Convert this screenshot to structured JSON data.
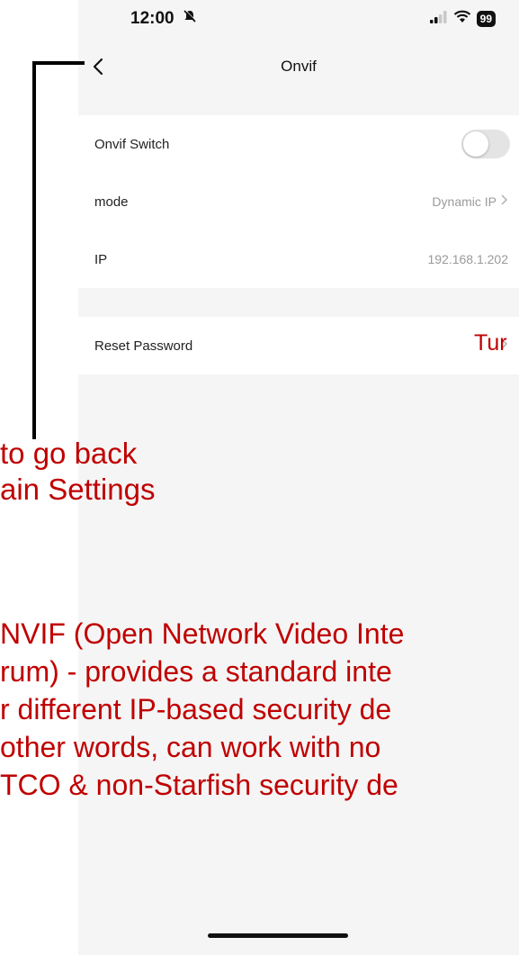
{
  "status_bar": {
    "time": "12:00",
    "battery": "99"
  },
  "nav": {
    "title": "Onvif"
  },
  "settings": {
    "onvif_switch_label": "Onvif Switch",
    "mode_label": "mode",
    "mode_value": "Dynamic IP",
    "ip_label": "IP",
    "ip_value": "192.168.1.202",
    "reset_password_label": "Reset Password"
  },
  "annotations": {
    "back_line1": "to go back",
    "back_line2": "ain Settings",
    "turn_text": "Tur",
    "onvif_desc": [
      "NVIF (Open Network Video Inte",
      "rum) - provides a standard inte",
      "r different IP-based security de",
      "other words, can work with no",
      "TCO & non-Starfish security de"
    ]
  },
  "colors": {
    "annotation": "#c00000",
    "background": "#f5f5f5"
  }
}
